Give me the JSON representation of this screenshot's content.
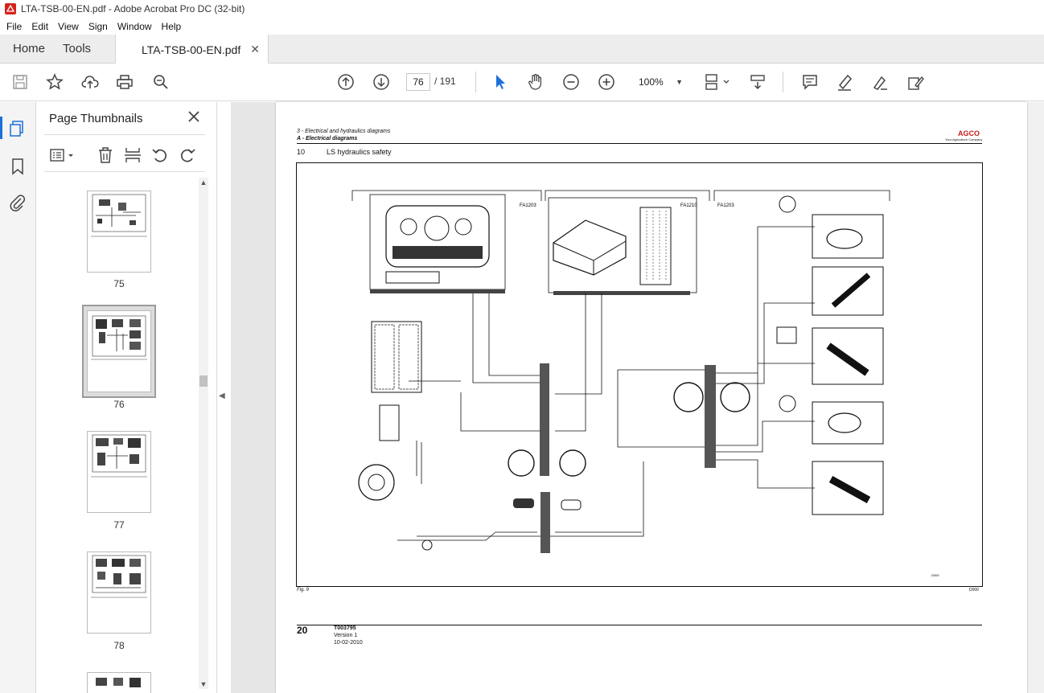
{
  "window": {
    "title": "LTA-TSB-00-EN.pdf - Adobe Acrobat Pro DC (32-bit)"
  },
  "menu": {
    "items": [
      "File",
      "Edit",
      "View",
      "Sign",
      "Window",
      "Help"
    ]
  },
  "tabs": {
    "home": "Home",
    "tools": "Tools",
    "document": "LTA-TSB-00-EN.pdf"
  },
  "toolbar": {
    "current_page": "76",
    "page_total": "/ 191",
    "zoom": "100%",
    "icons": [
      "save-icon",
      "bookmark-star-icon",
      "upload-icon",
      "print-icon",
      "find-icon",
      "page-up-icon",
      "page-down-icon",
      "select-cursor-icon",
      "hand-icon",
      "zoom-out-icon",
      "zoom-in-icon",
      "fit-page-icon",
      "scroll-mode-icon",
      "comment-icon",
      "highlight-icon",
      "sign-icon",
      "fill-sign-icon"
    ]
  },
  "panel": {
    "title": "Page Thumbnails",
    "thumbnails": [
      {
        "label": "75"
      },
      {
        "label": "76"
      },
      {
        "label": "77"
      },
      {
        "label": "78"
      }
    ]
  },
  "pdf": {
    "header_section": "3 - Electrical and hydraulics diagrams",
    "header_sub": "A - Electrical diagrams",
    "section_number": "10",
    "section_title": "LS hydraulics safety",
    "logo": "AGCO",
    "logo_tagline": "Your Agriculture Company",
    "figure_caption": "Fig. 9",
    "figure_ref": "D000",
    "page_number": "20",
    "doc_code": "T003795",
    "version": "Version 1",
    "date": "10-02-2010",
    "connector_labels": [
      "FA1203",
      "FA1210",
      "FA1203"
    ]
  }
}
